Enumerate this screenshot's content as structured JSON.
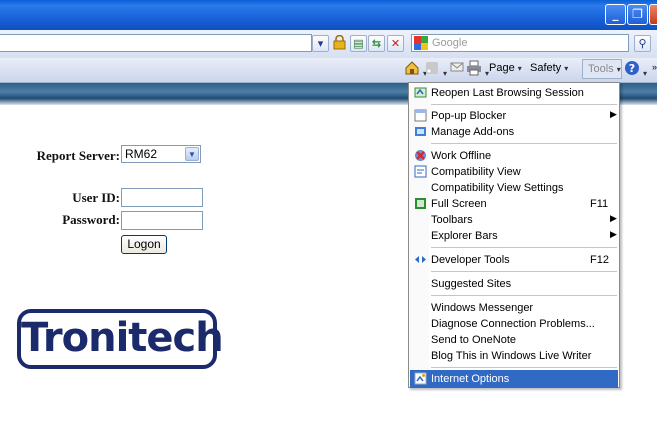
{
  "window": {
    "buttons": {
      "minimize": "_",
      "maximize": "❐",
      "close": "✕"
    }
  },
  "search": {
    "placeholder": "Google",
    "engine": "google-icon"
  },
  "commandbar": {
    "page_label": "Page",
    "safety_label": "Safety",
    "tools_label": "Tools"
  },
  "form": {
    "report_server_label": "Report Server:",
    "report_server_value": "RM62",
    "userid_label": "User ID:",
    "password_label": "Password:",
    "logon_label": "Logon",
    "userid_value": "",
    "password_value": ""
  },
  "logo": {
    "text": "Tronitech"
  },
  "tools_menu": {
    "items": [
      {
        "label": "Reopen Last Browsing Session",
        "icon": "reopen-session-icon"
      },
      {
        "label": "Pop-up Blocker",
        "submenu": true
      },
      {
        "label": "Manage Add-ons",
        "icon": "addons-icon"
      },
      {
        "label": "Work Offline",
        "icon": "work-offline-icon"
      },
      {
        "label": "Compatibility View",
        "icon": "compatibility-view-icon"
      },
      {
        "label": "Compatibility View Settings"
      },
      {
        "label": "Full Screen",
        "shortcut": "F11",
        "icon": "full-screen-icon"
      },
      {
        "label": "Toolbars",
        "submenu": true
      },
      {
        "label": "Explorer Bars",
        "submenu": true
      },
      {
        "label": "Developer Tools",
        "shortcut": "F12",
        "icon": "developer-tools-icon"
      },
      {
        "label": "Suggested Sites"
      },
      {
        "label": "Windows Messenger"
      },
      {
        "label": "Diagnose Connection Problems..."
      },
      {
        "label": "Send to OneNote"
      },
      {
        "label": "Blog This in Windows Live Writer"
      },
      {
        "label": "Internet Options",
        "icon": "internet-options-icon",
        "highlighted": true
      }
    ]
  },
  "colors": {
    "titlebar": "#1a62d8",
    "menu_highlight": "#316ac5",
    "logo": "#1b2a6b"
  }
}
